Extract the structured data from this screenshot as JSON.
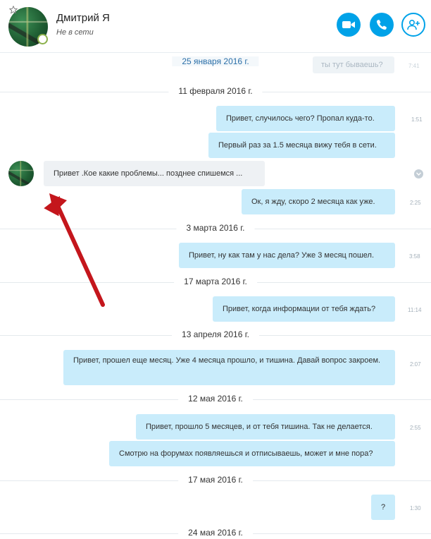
{
  "contact": {
    "name": "Дмитрий Я",
    "status": "Не в сети"
  },
  "header_buttons": [
    {
      "icon": "video-camera-icon"
    },
    {
      "icon": "phone-icon"
    },
    {
      "icon": "add-person-icon"
    }
  ],
  "colors": {
    "accent": "#00a2e8",
    "outgoing_bubble": "#c9ecfb",
    "incoming_bubble": "#eef1f4",
    "annotation_arrow": "#c4161c"
  },
  "dates": [
    "25 января 2016 г.",
    "11 февраля 2016 г.",
    "3 марта 2016 г.",
    "17 марта 2016 г.",
    "13 апреля 2016 г.",
    "12 мая 2016 г.",
    "17 мая 2016 г.",
    "24 мая 2016 г."
  ],
  "messages": [
    {
      "direction": "out",
      "text": "ты тут бываешь?",
      "time": "7:41"
    },
    {
      "direction": "out",
      "text": "Привет, случилось чего? Пропал куда-то.",
      "time": "1:51"
    },
    {
      "direction": "out",
      "text": "Первый раз за 1.5 месяца вижу тебя в сети.",
      "time": ""
    },
    {
      "direction": "in",
      "text": "Привет .Кое какие проблемы... позднее спишемся ...",
      "time": ""
    },
    {
      "direction": "out",
      "text": "Ок, я жду, скоро 2 месяца как уже.",
      "time": "2:25"
    },
    {
      "direction": "out",
      "text": "Привет, ну как там у нас дела? Уже 3 месяц пошел.",
      "time": "3:58"
    },
    {
      "direction": "out",
      "text": "Привет, когда информации от тебя ждать?",
      "time": "11:14"
    },
    {
      "direction": "out",
      "text": "Привет, прошел еще месяц. Уже 4 месяца прошло, и тишина. Давай вопрос закроем.",
      "time": "2:07"
    },
    {
      "direction": "out",
      "text": "Привет, прошло 5 месяцев, и от тебя тишина. Так не делается.",
      "time": "2:55"
    },
    {
      "direction": "out",
      "text": "Смотрю на форумах появляешься и отписываешь, может и мне пора?",
      "time": ""
    },
    {
      "direction": "out",
      "text": "?",
      "time": "1:30"
    }
  ]
}
